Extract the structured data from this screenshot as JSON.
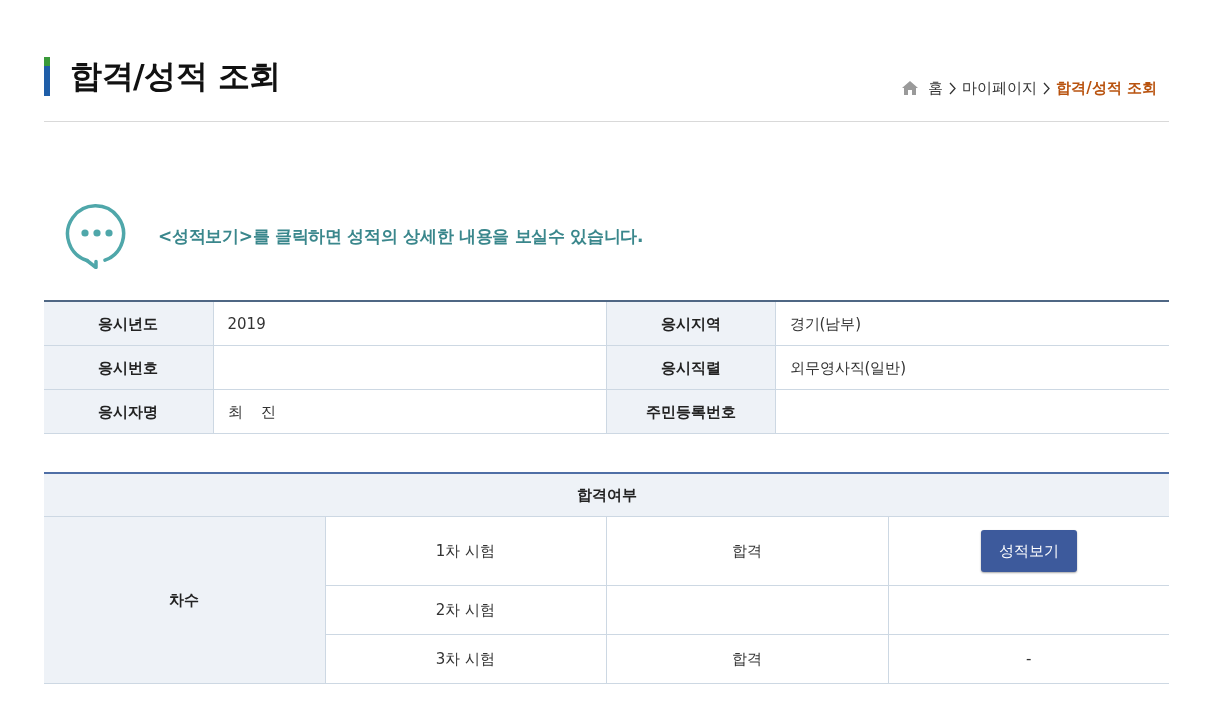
{
  "page": {
    "title": "합격/성적 조회"
  },
  "breadcrumb": [
    {
      "kind": "home",
      "label": "홈"
    },
    {
      "kind": "link",
      "label": "마이페이지"
    },
    {
      "kind": "current",
      "label": "합격/성적 조회"
    }
  ],
  "notice": {
    "text": "<성적보기>를 클릭하면 성적의 상세한 내용을 보실수 있습니다."
  },
  "applicant_info": {
    "rows": [
      [
        {
          "label": "응시년도",
          "value": "2019"
        },
        {
          "label": "응시지역",
          "value": "경기(남부)"
        }
      ],
      [
        {
          "label": "응시번호"
        },
        {
          "label": "응시직렬",
          "value": "외무영사직(일반)"
        }
      ],
      [
        {
          "label": "응시자명",
          "value": "최 진"
        },
        {
          "label": "주민등록번호"
        }
      ]
    ]
  },
  "result_table": {
    "header": "합격여부",
    "row_header": "차수",
    "rows": [
      {
        "exam": "1차 시험",
        "result": "합격",
        "action": {
          "kind": "button",
          "label": "성적보기"
        }
      },
      {
        "exam": "2차 시험"
      },
      {
        "exam": "3차 시험",
        "result": "합격",
        "action": {
          "kind": "text",
          "label": "-"
        }
      }
    ]
  }
}
